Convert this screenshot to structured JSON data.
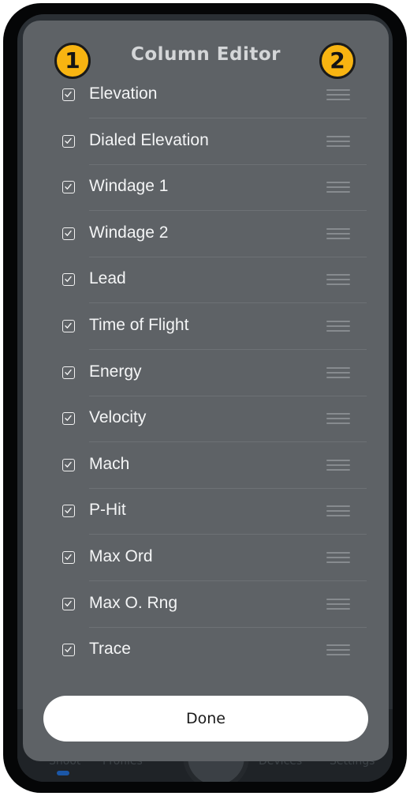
{
  "modal": {
    "title": "Column Editor",
    "badges": [
      "1",
      "2"
    ],
    "items": [
      {
        "label": "Elevation",
        "checked": true
      },
      {
        "label": "Dialed Elevation",
        "checked": true
      },
      {
        "label": "Windage 1",
        "checked": true
      },
      {
        "label": "Windage 2",
        "checked": true
      },
      {
        "label": "Lead",
        "checked": true
      },
      {
        "label": "Time of Flight",
        "checked": true
      },
      {
        "label": "Energy",
        "checked": true
      },
      {
        "label": "Velocity",
        "checked": true
      },
      {
        "label": "Mach",
        "checked": true
      },
      {
        "label": "P-Hit",
        "checked": true
      },
      {
        "label": "Max Ord",
        "checked": true
      },
      {
        "label": "Max O. Rng",
        "checked": true
      },
      {
        "label": "Trace",
        "checked": true
      }
    ],
    "done_label": "Done"
  },
  "background": {
    "tabs": [
      "Shoot",
      "Profiles",
      "Devices",
      "Settings"
    ]
  },
  "colors": {
    "badge": "#f8b411",
    "modal_bg": "#5e6266",
    "accent": "#1a64c8"
  }
}
